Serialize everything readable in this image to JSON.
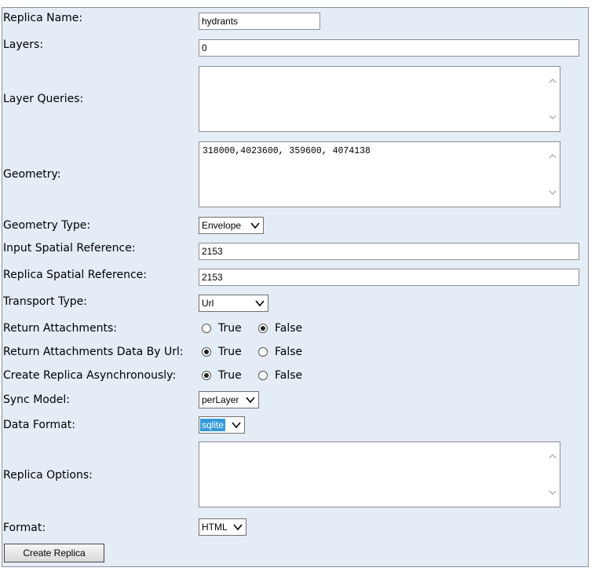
{
  "form": {
    "replica_name": {
      "label": "Replica Name:",
      "value": "hydrants"
    },
    "layers": {
      "label": "Layers:",
      "value": "0"
    },
    "layer_queries": {
      "label": "Layer Queries:",
      "value": ""
    },
    "geometry": {
      "label": "Geometry:",
      "value": "318000,4023600, 359600, 4074138"
    },
    "geometry_type": {
      "label": "Geometry Type:",
      "value": "Envelope"
    },
    "input_spatial_reference": {
      "label": "Input Spatial Reference:",
      "value": "2153"
    },
    "replica_spatial_reference": {
      "label": "Replica Spatial Reference:",
      "value": "2153"
    },
    "transport_type": {
      "label": "Transport Type:",
      "value": "Url"
    },
    "return_attachments": {
      "label": "Return Attachments:",
      "true_label": "True",
      "false_label": "False",
      "selected": "False"
    },
    "return_attachments_by_url": {
      "label": "Return Attachments Data By Url:",
      "true_label": "True",
      "false_label": "False",
      "selected": "True"
    },
    "create_async": {
      "label": "Create Replica Asynchronously:",
      "true_label": "True",
      "false_label": "False",
      "selected": "True"
    },
    "sync_model": {
      "label": "Sync Model:",
      "value": "perLayer"
    },
    "data_format": {
      "label": "Data Format:",
      "value": "sqlite"
    },
    "replica_options": {
      "label": "Replica Options:",
      "value": ""
    },
    "format": {
      "label": "Format:",
      "value": "HTML"
    },
    "submit_label": "Create Replica"
  },
  "icons": {
    "dropdown": "chevron-down-icon",
    "scroll_up": "scroll-up-arrow-icon",
    "scroll_down": "scroll-down-arrow-icon"
  },
  "colors": {
    "panel_bg": "#e4ecf6",
    "selection_highlight": "#3399dd"
  }
}
